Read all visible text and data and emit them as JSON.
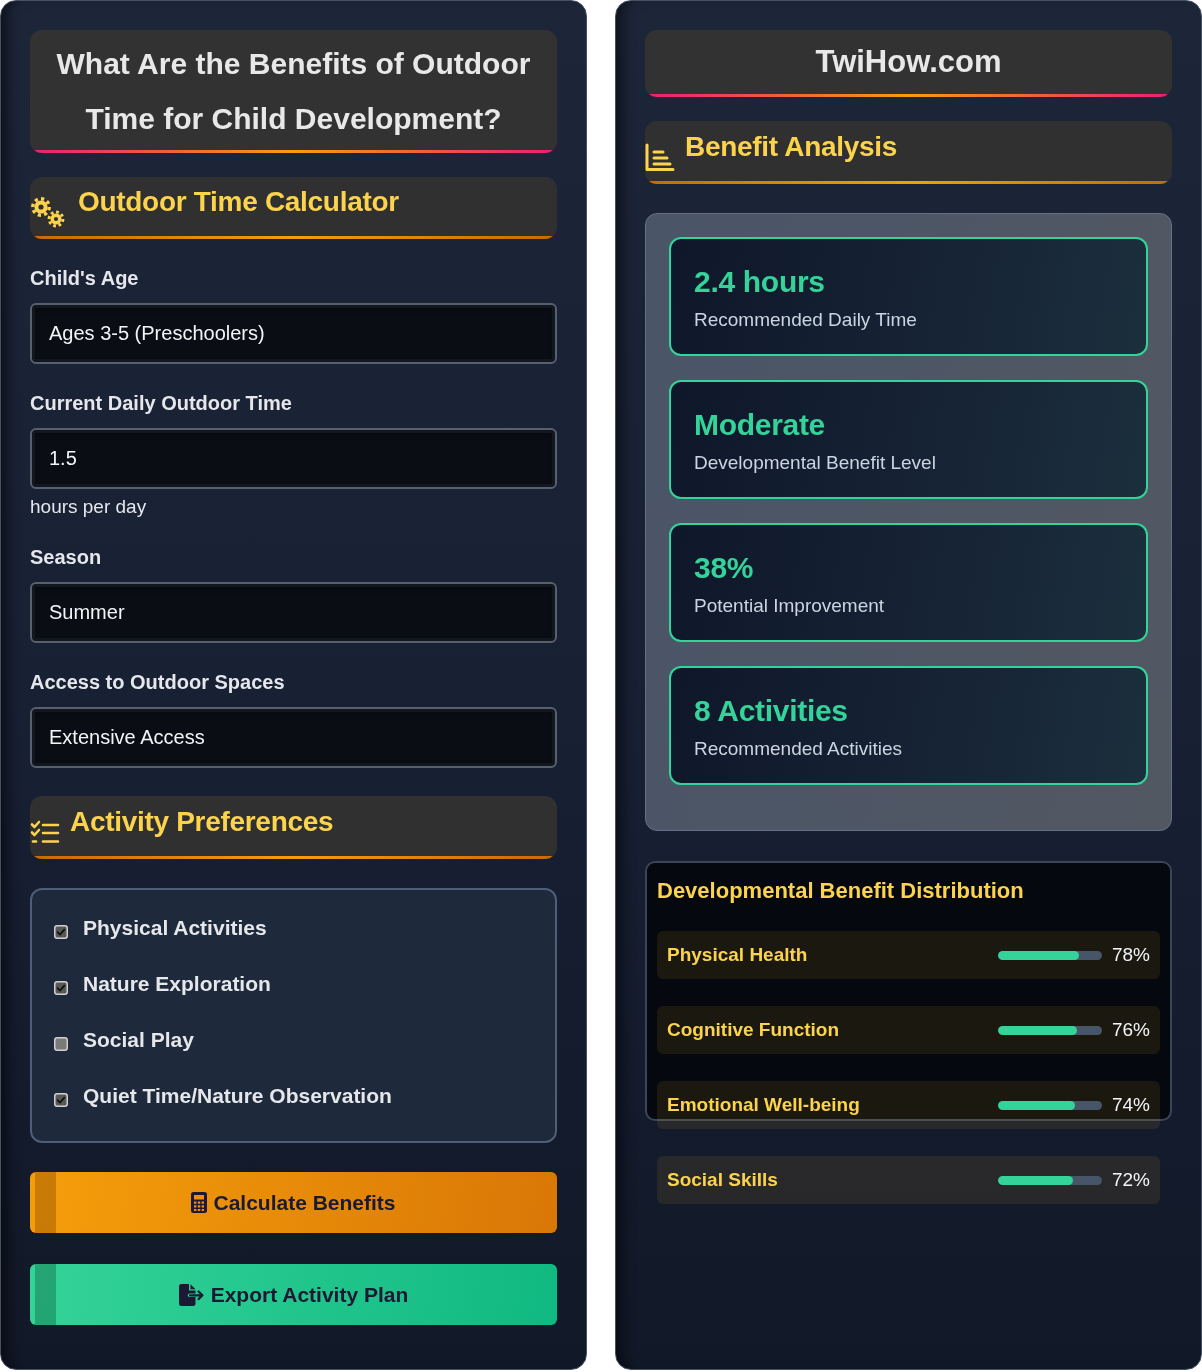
{
  "left": {
    "title": "What Are the Benefits of Outdoor Time for Child Development?",
    "calculator": {
      "heading": "Outdoor Time Calculator",
      "fields": [
        {
          "label": "Child's Age",
          "value": "Ages 3-5 (Preschoolers)"
        },
        {
          "label": "Current Daily Outdoor Time",
          "value": "1.5",
          "hint": "hours per day"
        },
        {
          "label": "Season",
          "value": "Summer"
        },
        {
          "label": "Access to Outdoor Spaces",
          "value": "Extensive Access"
        }
      ]
    },
    "preferences": {
      "heading": "Activity Preferences",
      "options": [
        {
          "label": "Physical Activities",
          "checked": true
        },
        {
          "label": "Nature Exploration",
          "checked": true
        },
        {
          "label": "Social Play",
          "checked": false
        },
        {
          "label": "Quiet Time/Nature Observation",
          "checked": true
        }
      ]
    },
    "buttons": [
      {
        "kind": "calculate",
        "label": "Calculate Benefits"
      },
      {
        "kind": "export",
        "label": "Export Activity Plan"
      }
    ]
  },
  "right": {
    "site": "TwiHow.com",
    "analysis": {
      "heading": "Benefit Analysis",
      "results": [
        {
          "value": "2.4 hours",
          "label": "Recommended Daily Time"
        },
        {
          "value": "Moderate",
          "label": "Developmental Benefit Level"
        },
        {
          "value": "38%",
          "label": "Potential Improvement"
        },
        {
          "value": "8 Activities",
          "label": "Recommended Activities"
        }
      ]
    },
    "distribution": {
      "title": "Developmental Benefit Distribution",
      "items": [
        {
          "name": "Physical Health",
          "level": 0.78,
          "reading": "78%"
        },
        {
          "name": "Cognitive Function",
          "level": 0.76,
          "reading": "76%"
        },
        {
          "name": "Emotional Well-being",
          "level": 0.74,
          "reading": "74%"
        },
        {
          "name": "Social Skills",
          "level": 0.72,
          "reading": "72%"
        }
      ]
    }
  }
}
